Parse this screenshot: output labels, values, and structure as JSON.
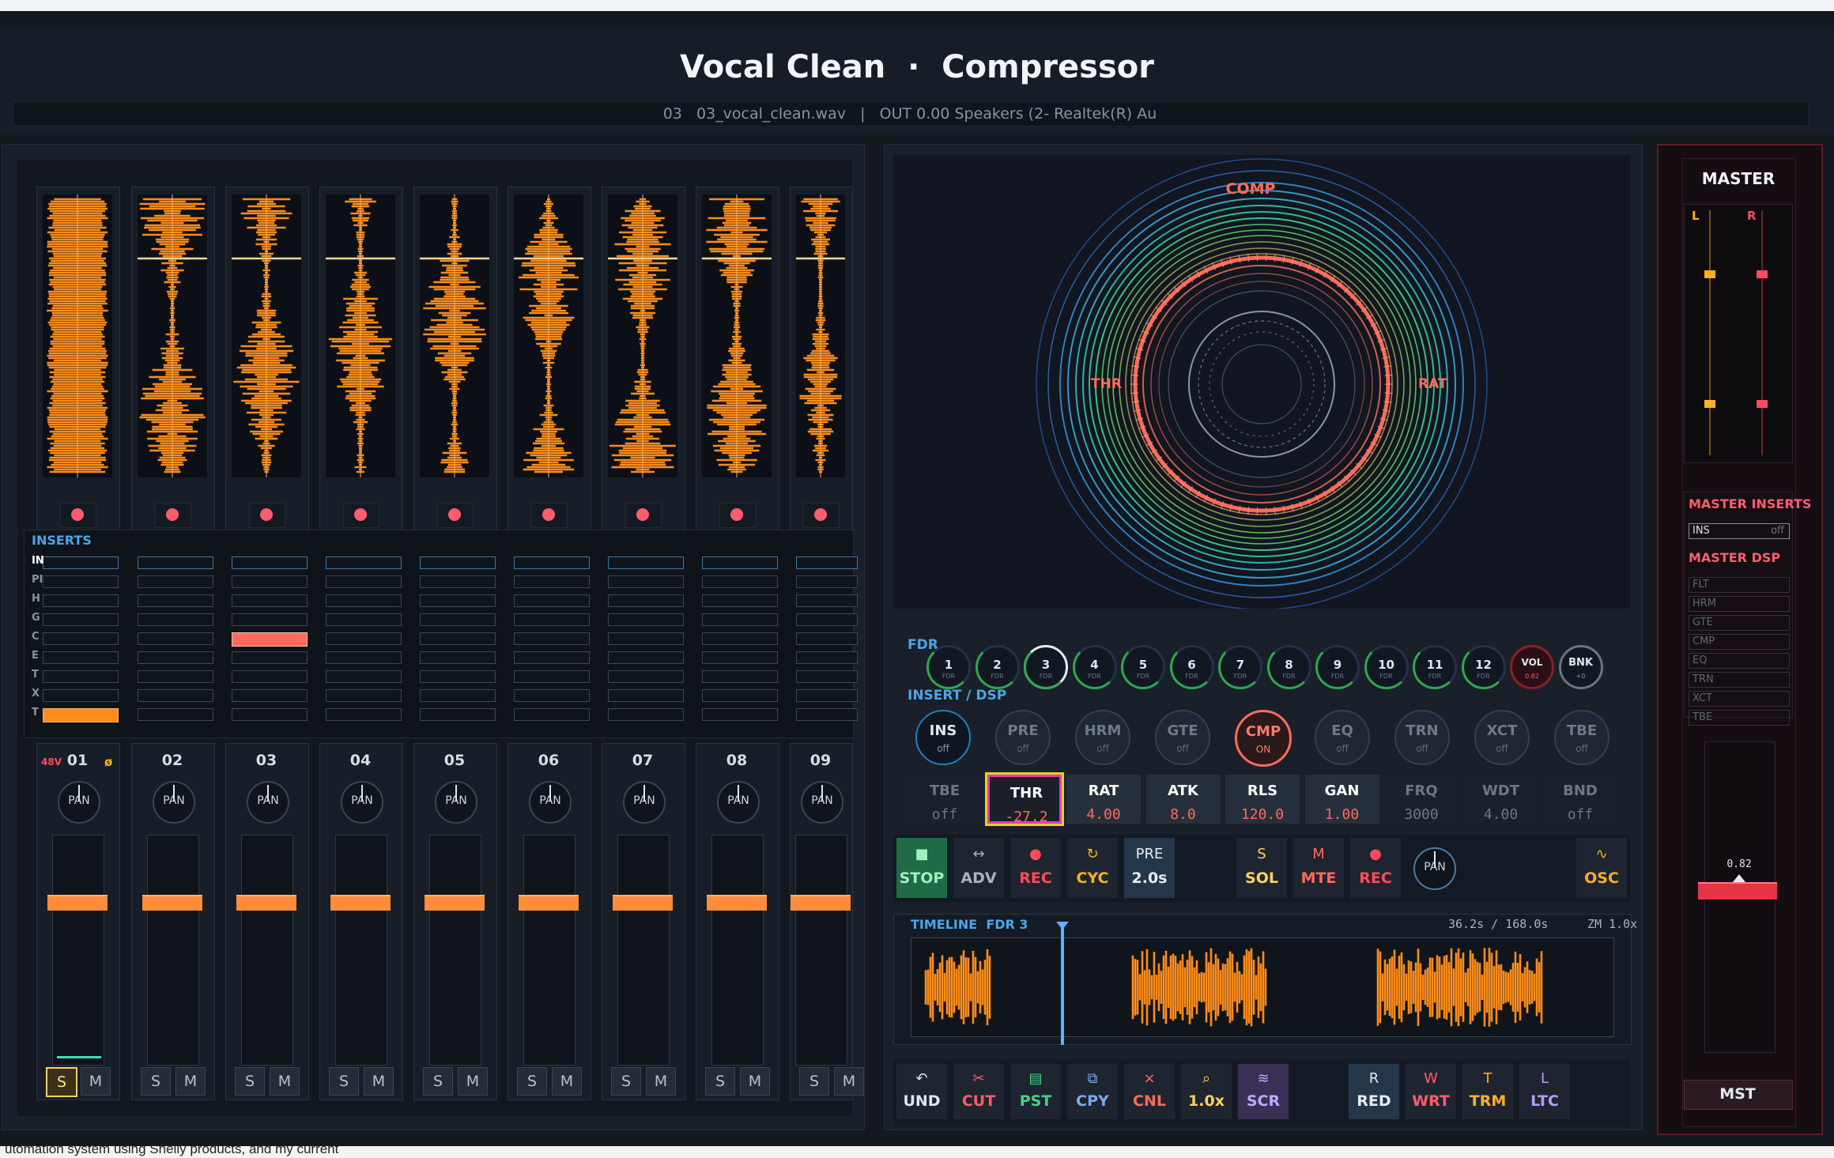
{
  "header": {
    "title": "Vocal Clean  ·  Compressor",
    "subtitle": "03   03_vocal_clean.wav   |   OUT 0.00 Speakers (2- Realtek(R) Au"
  },
  "mixer": {
    "inserts_label": "INSERTS",
    "insert_row_labels": [
      "IN",
      "PI",
      "H",
      "G",
      "C",
      "E",
      "T",
      "X",
      "T"
    ],
    "phantom_label": "48V",
    "phase_label": "ø",
    "channels": [
      {
        "num": "01",
        "solo_active": true
      },
      {
        "num": "02",
        "solo_active": false
      },
      {
        "num": "03",
        "solo_active": false
      },
      {
        "num": "04",
        "solo_active": false
      },
      {
        "num": "05",
        "solo_active": false
      },
      {
        "num": "06",
        "solo_active": false
      },
      {
        "num": "07",
        "solo_active": false
      },
      {
        "num": "08",
        "solo_active": false
      },
      {
        "num": "09",
        "solo_active": false
      }
    ],
    "pan_label": "PAN",
    "solo_label": "S",
    "mute_label": "M"
  },
  "ring": {
    "top_label": "COMP",
    "left_label": "THR",
    "right_label": "RAT"
  },
  "fdr": {
    "label": "FDR",
    "buttons": [
      "1",
      "2",
      "3",
      "4",
      "5",
      "6",
      "7",
      "8",
      "9",
      "10",
      "11",
      "12"
    ],
    "sub": "FDR",
    "selected": "3",
    "vol_label": "VOL",
    "vol_value": "0.82",
    "bnk_label": "BNK",
    "bnk_value": "+0"
  },
  "dsp": {
    "label": "INSERT / DSP",
    "modules": [
      {
        "name": "INS",
        "state": "off"
      },
      {
        "name": "PRE",
        "state": "off"
      },
      {
        "name": "HRM",
        "state": "off"
      },
      {
        "name": "GTE",
        "state": "off"
      },
      {
        "name": "CMP",
        "state": "ON"
      },
      {
        "name": "EQ",
        "state": "off"
      },
      {
        "name": "TRN",
        "state": "off"
      },
      {
        "name": "XCT",
        "state": "off"
      },
      {
        "name": "TBE",
        "state": "off"
      }
    ]
  },
  "params": [
    {
      "name": "TBE",
      "value": "off"
    },
    {
      "name": "THR",
      "value": "-27.2"
    },
    {
      "name": "RAT",
      "value": "4.00"
    },
    {
      "name": "ATK",
      "value": "8.0"
    },
    {
      "name": "RLS",
      "value": "120.0"
    },
    {
      "name": "GAN",
      "value": "1.00"
    },
    {
      "name": "FRQ",
      "value": "3000"
    },
    {
      "name": "WDT",
      "value": "4.00"
    },
    {
      "name": "BND",
      "value": "off"
    }
  ],
  "transport": {
    "stop": {
      "icon": "■",
      "label": "STOP"
    },
    "adv": {
      "icon": "↔",
      "label": "ADV"
    },
    "rec": {
      "icon": "●",
      "label": "REC"
    },
    "cyc": {
      "icon": "↻",
      "label": "CYC"
    },
    "pre": {
      "icon": "PRE",
      "label": "2.0s"
    },
    "sol": {
      "icon": "S",
      "label": "SOL"
    },
    "mte": {
      "icon": "M",
      "label": "MTE"
    },
    "rec2": {
      "icon": "●",
      "label": "REC"
    },
    "pan": "PAN",
    "osc": {
      "icon": "∿",
      "label": "OSC"
    }
  },
  "timeline": {
    "label": "TIMELINE  FDR 3",
    "position": "36.2s / 168.0s",
    "zoom": "ZM 1.0x"
  },
  "edit": {
    "und": {
      "icon": "↶",
      "label": "UND"
    },
    "cut": {
      "icon": "✂",
      "label": "CUT"
    },
    "pst": {
      "icon": "▤",
      "label": "PST"
    },
    "cpy": {
      "icon": "⧉",
      "label": "CPY"
    },
    "cnl": {
      "icon": "×",
      "label": "CNL"
    },
    "spd": {
      "icon": "⌕",
      "label": "1.0x"
    },
    "scr": {
      "icon": "≋",
      "label": "SCR"
    },
    "red": {
      "icon": "R",
      "label": "RED"
    },
    "wrt": {
      "icon": "W",
      "label": "WRT"
    },
    "trm": {
      "icon": "T",
      "label": "TRM"
    },
    "ltc": {
      "icon": "L",
      "label": "LTC"
    }
  },
  "master": {
    "title": "MASTER",
    "l": "L",
    "r": "R",
    "inserts_label": "MASTER INSERTS",
    "ins_name": "INS",
    "ins_state": "off",
    "dsp_label": "MASTER DSP",
    "dsp_items": [
      "FLT",
      "HRM",
      "GTE",
      "CMP",
      "EQ",
      "TRN",
      "XCT",
      "TBE"
    ],
    "fader_value": "0.82",
    "mst_label": "MST"
  },
  "bottom": {
    "text": "utomation system using Shelly products, and my current"
  },
  "colors": {
    "accent_orange": "#ff8c1a",
    "comp_red": "#ff6b5b",
    "bg": "#14181f"
  }
}
